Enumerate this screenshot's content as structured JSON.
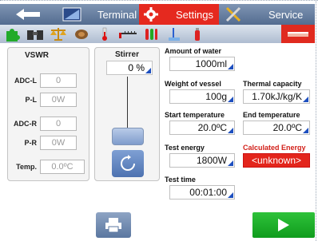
{
  "tabs": {
    "terminal": "Terminal",
    "settings": "Settings",
    "service": "Service"
  },
  "icons": [
    "puzzle-icon",
    "binoculars-icon",
    "balance-scale-icon",
    "coil-icon",
    "thermometer-icon",
    "ruler-icon",
    "test-tubes-icon",
    "probe-icon",
    "bottle-icon",
    "red-selected-icon"
  ],
  "vswr": {
    "title": "VSWR",
    "rows": [
      {
        "label": "ADC-L",
        "value": "0"
      },
      {
        "label": "P-L",
        "value": "0W"
      },
      {
        "label": "ADC-R",
        "value": "0"
      },
      {
        "label": "P-R",
        "value": "0W"
      },
      {
        "label": "Temp.",
        "value": "0.0ºC"
      }
    ]
  },
  "stirrer": {
    "title": "Stirrer",
    "value": "0 %"
  },
  "settings": {
    "water": {
      "label": "Amount of water",
      "value": "1000ml"
    },
    "vessel_weight": {
      "label": "Weight of vessel",
      "value": "100g"
    },
    "thermal_capacity": {
      "label": "Thermal capacity",
      "value": "1.70kJ/kg/K"
    },
    "start_temp": {
      "label": "Start temperature",
      "value": "20.0ºC"
    },
    "end_temp": {
      "label": "End temperature",
      "value": "20.0ºC"
    },
    "test_energy": {
      "label": "Test energy",
      "value": "1800W"
    },
    "calc_energy": {
      "label": "Calculated Energy",
      "value": "<unknown>"
    },
    "test_time": {
      "label": "Test time",
      "value": "00:01:00"
    }
  },
  "colors": {
    "accent_red": "#e5291f",
    "tab_blue": "#536c90",
    "start_green": "#1ab02a"
  }
}
